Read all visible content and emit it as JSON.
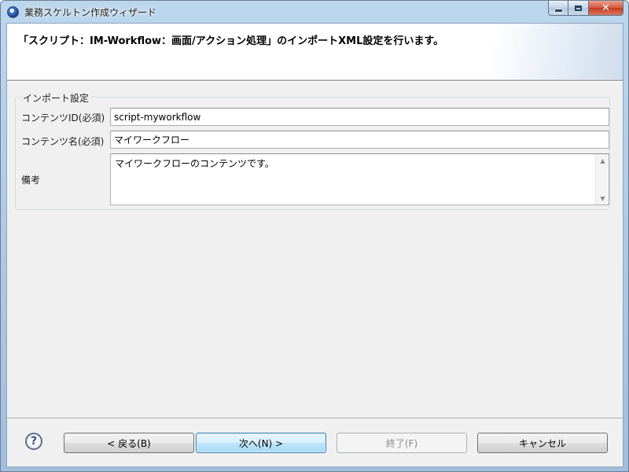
{
  "window": {
    "title": "業務スケルトン作成ウィザード",
    "controls": {
      "minimize": "minimize",
      "maximize": "maximize",
      "close": "✕"
    }
  },
  "header": {
    "title": "「スクリプト：IM-Workflow：画面/アクション処理」のインポートXML設定を行います。"
  },
  "import_settings": {
    "legend": "インポート設定",
    "content_id": {
      "label": "コンテンツID(必須)",
      "value": "script-myworkflow"
    },
    "content_name": {
      "label": "コンテンツ名(必須)",
      "value": "マイワークフロー"
    },
    "remarks": {
      "label": "備考",
      "value": "マイワークフローのコンテンツです。"
    }
  },
  "buttons": {
    "help": "?",
    "back": "< 戻る(B)",
    "next": "次へ(N) >",
    "finish": "終了(F)",
    "cancel": "キャンセル"
  },
  "state": {
    "finish_enabled": false,
    "default_button": "next"
  }
}
